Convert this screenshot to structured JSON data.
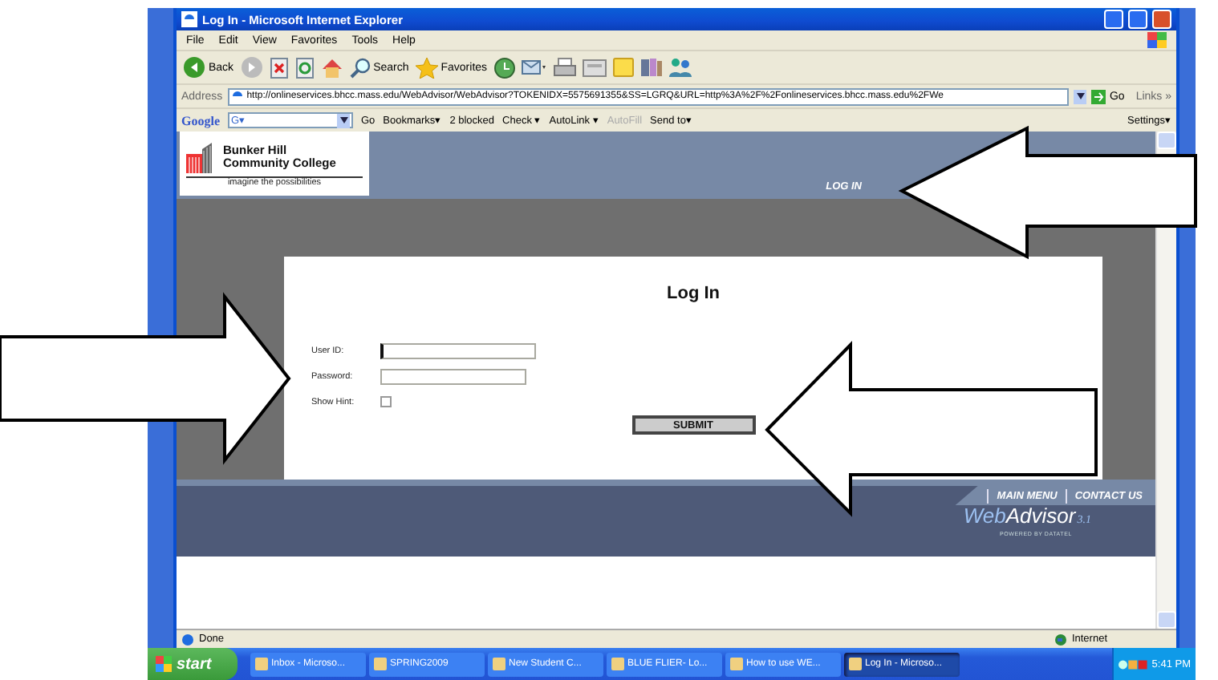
{
  "window": {
    "title": "Log In - Microsoft Internet Explorer"
  },
  "menu": [
    "File",
    "Edit",
    "View",
    "Favorites",
    "Tools",
    "Help"
  ],
  "toolbar": [
    {
      "kind": "back",
      "label": "Back"
    },
    {
      "kind": "forward"
    },
    {
      "kind": "stop"
    },
    {
      "kind": "refresh"
    },
    {
      "kind": "home"
    },
    {
      "kind": "search",
      "label": "Search"
    },
    {
      "kind": "favorites",
      "label": "Favorites"
    },
    {
      "kind": "history"
    },
    {
      "kind": "mail"
    },
    {
      "kind": "print"
    },
    {
      "kind": "edit"
    },
    {
      "kind": "note"
    },
    {
      "kind": "research"
    },
    {
      "kind": "messenger"
    }
  ],
  "address_bar": {
    "label": "Address",
    "url": "http://onlineservices.bhcc.mass.edu/WebAdvisor/WebAdvisor?TOKENIDX=5575691355&SS=LGRQ&URL=http%3A%2F%2Fonlineservices.bhcc.mass.edu%2FWe",
    "go": "Go",
    "links": "Links »"
  },
  "google_bar": {
    "brand": "Google",
    "field": "G▾",
    "go": "Go",
    "items": [
      {
        "label": "Bookmarks▾",
        "disabled": false
      },
      {
        "label": "2 blocked",
        "disabled": false
      },
      {
        "label": "Check ▾",
        "disabled": false
      },
      {
        "label": "AutoLink ▾",
        "disabled": false
      },
      {
        "label": "AutoFill",
        "disabled": true
      },
      {
        "label": "Send to▾",
        "disabled": false
      }
    ],
    "settings": "Settings▾"
  },
  "site": {
    "logo": {
      "name_line_1": "Bunker Hill",
      "name_line_2": "Community College",
      "tagline": "imagine the possibilities"
    },
    "top_nav": [
      "LOG IN"
    ],
    "form": {
      "title": "Log In",
      "fields": [
        {
          "kind": "text",
          "label": "User ID:",
          "focused": true
        },
        {
          "kind": "password",
          "label": "Password:",
          "focused": false
        },
        {
          "kind": "checkbox",
          "label": "Show Hint:",
          "checked": false
        }
      ],
      "submit": "SUBMIT"
    },
    "footer_nav": [
      "MAIN MENU",
      "CONTACT US"
    ],
    "brand": {
      "name_part_1": "Web",
      "name_part_2": "Advisor",
      "version": "3.1",
      "tagline": "POWERED BY DATATEL"
    }
  },
  "status_bar": {
    "text": "Done",
    "zone": "Internet"
  },
  "taskbar": {
    "start": "start",
    "items": [
      {
        "label": "Inbox - Microso...",
        "selected": false
      },
      {
        "label": "SPRING2009",
        "selected": false
      },
      {
        "label": "New Student C...",
        "selected": false
      },
      {
        "label": "BLUE FLIER- Lo...",
        "selected": false
      },
      {
        "label": "How to use WE...",
        "selected": false
      },
      {
        "label": "Log In - Microso...",
        "selected": true
      }
    ],
    "clock": "5:41 PM"
  }
}
